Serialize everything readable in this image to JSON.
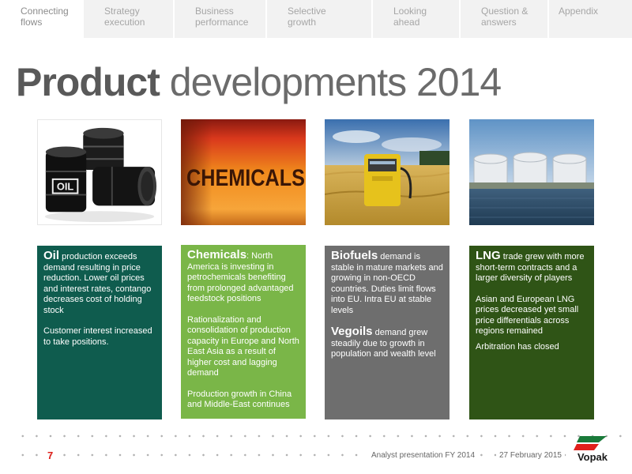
{
  "nav": {
    "tabs": [
      {
        "label": "Connecting\nflows",
        "active": true
      },
      {
        "label": "Strategy\nexecution",
        "active": false
      },
      {
        "label": "Business\nperformance",
        "active": false
      },
      {
        "label": "Selective\ngrowth",
        "active": false
      },
      {
        "label": "Looking\nahead",
        "active": false
      },
      {
        "label": "Question &\nanswers",
        "active": false
      },
      {
        "label": "Appendix",
        "active": false
      }
    ]
  },
  "title": {
    "bold": "Product",
    "rest": " developments 2014"
  },
  "images": {
    "oil_label": "OIL",
    "chemicals_label": "CHEMICALS"
  },
  "boxes": {
    "oil": {
      "lead": "Oil",
      "text": " production exceeds demand resulting in price reduction. Lower oil prices and interest rates, contango decreases cost of holding stock",
      "p2": "Customer interest increased to take positions."
    },
    "chemicals": {
      "lead": "Chemicals",
      "text": ": North America is investing in petrochemicals benefiting from prolonged advantaged feedstock positions",
      "p2": "Rationalization and consolidation of production capacity in Europe and North East Asia as a result of higher cost and lagging demand",
      "p3": "Production growth in China and Middle-East continues"
    },
    "biofuels": {
      "lead": "Biofuels",
      "text": " demand is stable in mature markets and growing in non-OECD countries. Duties limit flows into EU. Intra EU at stable levels",
      "lead2": "Vegoils",
      "text2": " demand grew steadily due to growth in population and wealth level"
    },
    "lng": {
      "lead": "LNG",
      "text": " trade grew with more short-term contracts and a larger diversity of players",
      "p2": "Asian and European LNG prices decreased yet small price differentials across regions remained",
      "p3": "Arbitration has closed"
    }
  },
  "footer": {
    "page_number": "7",
    "presentation": "Analyst presentation FY 2014",
    "date": "27 February 2015",
    "logo_text": "Vopak"
  },
  "colors": {
    "oil_box": "#0f5c4e",
    "chemicals_box": "#7ab648",
    "biofuels_box": "#6e6e6e",
    "lng_box": "#2f5416",
    "accent_red": "#e0201b"
  }
}
